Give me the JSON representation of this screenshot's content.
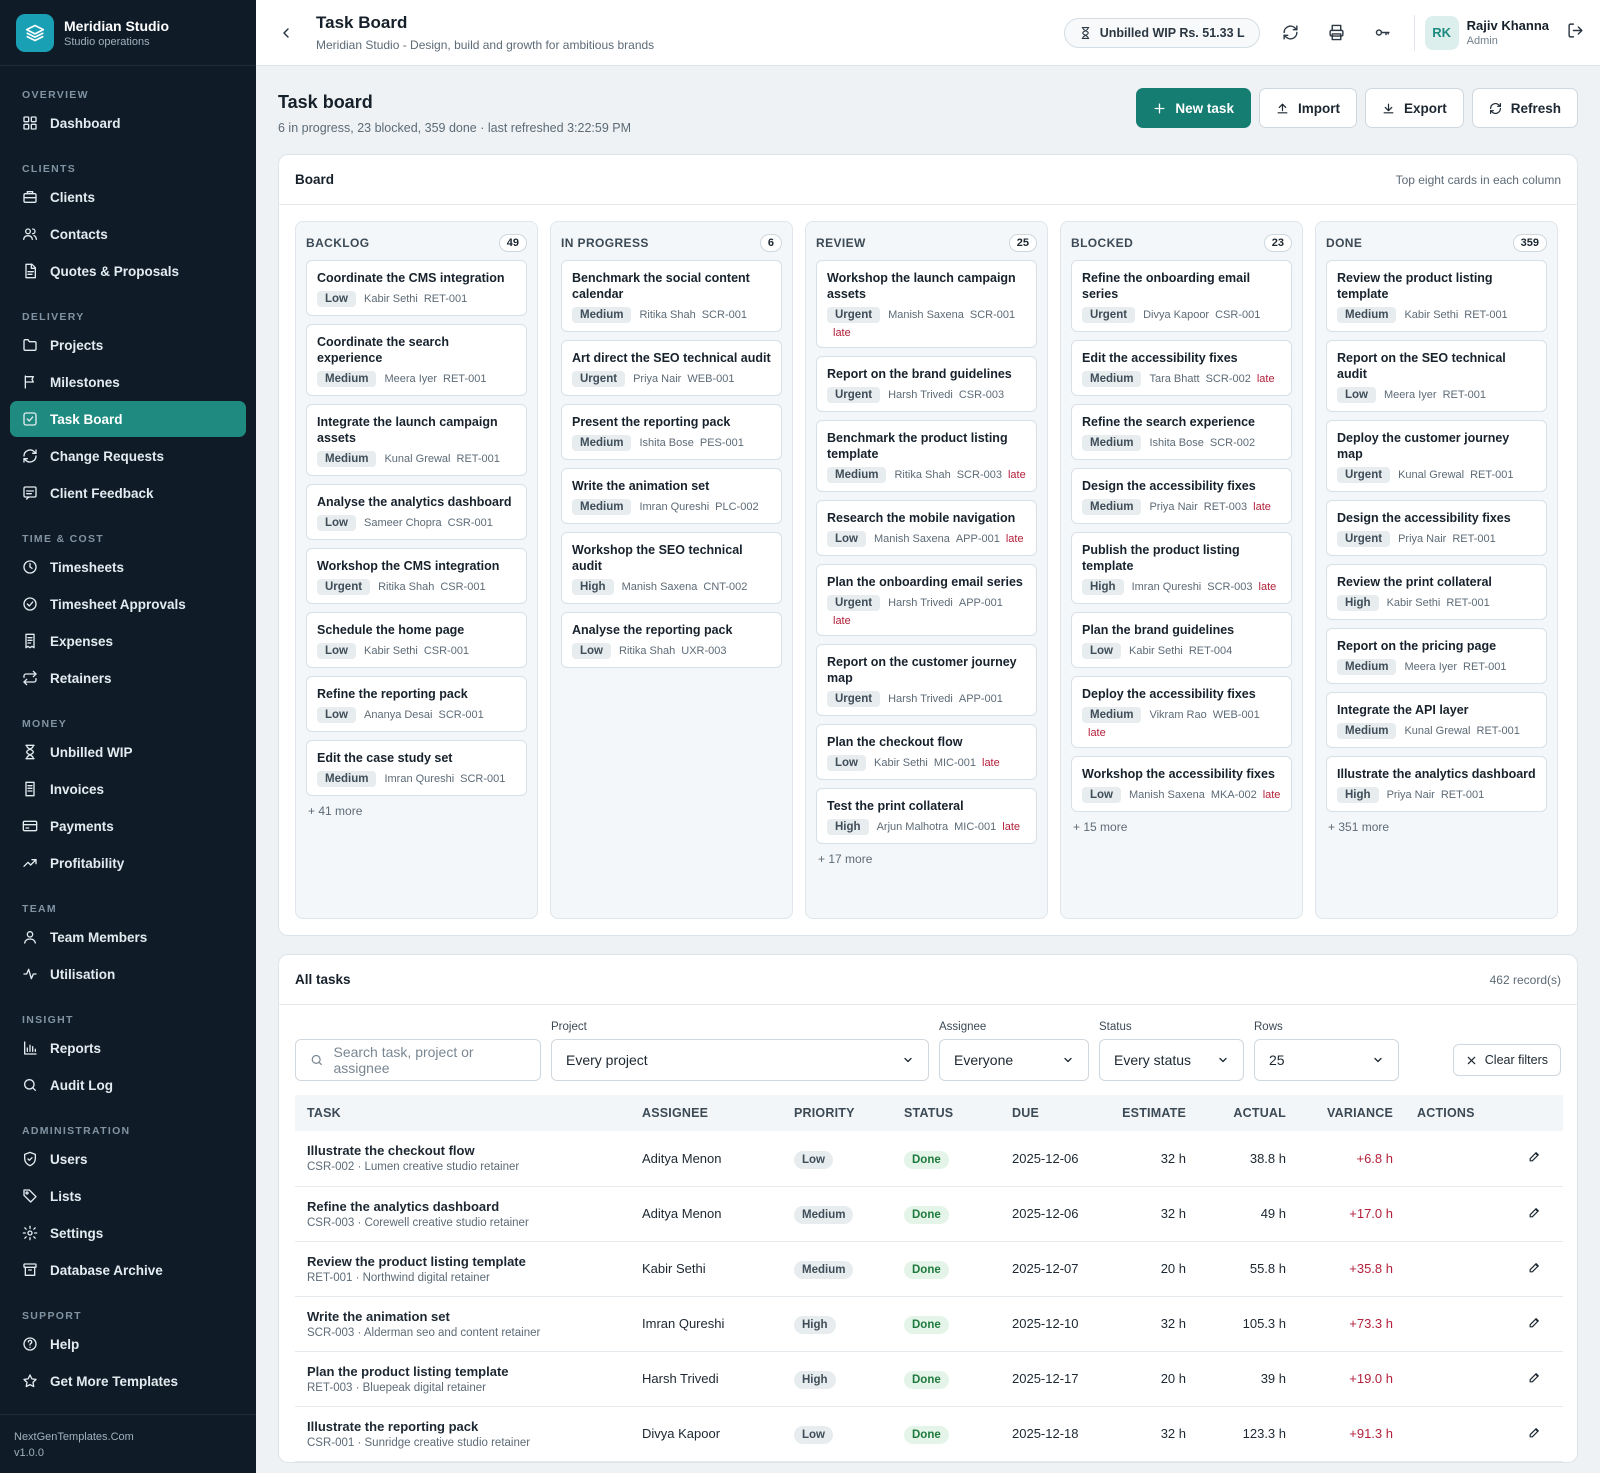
{
  "brand": {
    "name": "Meridian Studio",
    "subtitle": "Studio operations"
  },
  "nav": {
    "sections": [
      {
        "label": "OVERVIEW",
        "items": [
          {
            "label": "Dashboard",
            "icon": "grid-icon"
          }
        ]
      },
      {
        "label": "CLIENTS",
        "items": [
          {
            "label": "Clients",
            "icon": "briefcase-icon"
          },
          {
            "label": "Contacts",
            "icon": "users-icon"
          },
          {
            "label": "Quotes & Proposals",
            "icon": "document-icon"
          }
        ]
      },
      {
        "label": "DELIVERY",
        "items": [
          {
            "label": "Projects",
            "icon": "folder-icon"
          },
          {
            "label": "Milestones",
            "icon": "flag-icon"
          },
          {
            "label": "Task Board",
            "icon": "checkbox-icon",
            "active": true
          },
          {
            "label": "Change Requests",
            "icon": "refresh-icon"
          },
          {
            "label": "Client Feedback",
            "icon": "message-icon"
          }
        ]
      },
      {
        "label": "TIME & COST",
        "items": [
          {
            "label": "Timesheets",
            "icon": "clock-icon"
          },
          {
            "label": "Timesheet Approvals",
            "icon": "check-circle-icon"
          },
          {
            "label": "Expenses",
            "icon": "receipt-icon"
          },
          {
            "label": "Retainers",
            "icon": "repeat-icon"
          }
        ]
      },
      {
        "label": "MONEY",
        "items": [
          {
            "label": "Unbilled WIP",
            "icon": "hourglass-icon"
          },
          {
            "label": "Invoices",
            "icon": "invoice-icon"
          },
          {
            "label": "Payments",
            "icon": "card-icon"
          },
          {
            "label": "Profitability",
            "icon": "trend-icon"
          }
        ]
      },
      {
        "label": "TEAM",
        "items": [
          {
            "label": "Team Members",
            "icon": "user-icon"
          },
          {
            "label": "Utilisation",
            "icon": "pulse-icon"
          }
        ]
      },
      {
        "label": "INSIGHT",
        "items": [
          {
            "label": "Reports",
            "icon": "bar-chart-icon"
          },
          {
            "label": "Audit Log",
            "icon": "search-icon"
          }
        ]
      },
      {
        "label": "ADMINISTRATION",
        "items": [
          {
            "label": "Users",
            "icon": "shield-icon"
          },
          {
            "label": "Lists",
            "icon": "tag-icon"
          },
          {
            "label": "Settings",
            "icon": "gear-icon"
          },
          {
            "label": "Database Archive",
            "icon": "archive-icon"
          }
        ]
      },
      {
        "label": "SUPPORT",
        "items": [
          {
            "label": "Help",
            "icon": "help-icon"
          },
          {
            "label": "Get More Templates",
            "icon": "star-icon"
          }
        ]
      }
    ]
  },
  "footer": {
    "site": "NextGenTemplates.Com",
    "version": "v1.0.0"
  },
  "header": {
    "title": "Task Board",
    "subtitle": "Meridian Studio - Design, build and growth for ambitious brands",
    "wip": "Unbilled WIP Rs. 51.33 L",
    "user": {
      "initials": "RK",
      "name": "Rajiv Khanna",
      "role": "Admin"
    }
  },
  "page": {
    "title": "Task board",
    "subtitle": "6 in progress, 23 blocked, 359 done · last refreshed 3:22:59 PM",
    "actions": {
      "new": "New task",
      "import": "Import",
      "export": "Export",
      "refresh": "Refresh"
    }
  },
  "board": {
    "title": "Board",
    "note": "Top eight cards in each column",
    "columns": [
      {
        "name": "BACKLOG",
        "count": "49",
        "more": "+ 41 more",
        "cards": [
          {
            "title": "Coordinate the CMS integration",
            "priority": "Low",
            "assignee": "Kabir Sethi",
            "code": "RET-001",
            "late": ""
          },
          {
            "title": "Coordinate the search experience",
            "priority": "Medium",
            "assignee": "Meera Iyer",
            "code": "RET-001",
            "late": ""
          },
          {
            "title": "Integrate the launch campaign assets",
            "priority": "Medium",
            "assignee": "Kunal Grewal",
            "code": "RET-001",
            "late": ""
          },
          {
            "title": "Analyse the analytics dashboard",
            "priority": "Low",
            "assignee": "Sameer Chopra",
            "code": "CSR-001",
            "late": ""
          },
          {
            "title": "Workshop the CMS integration",
            "priority": "Urgent",
            "assignee": "Ritika Shah",
            "code": "CSR-001",
            "late": ""
          },
          {
            "title": "Schedule the home page",
            "priority": "Low",
            "assignee": "Kabir Sethi",
            "code": "CSR-001",
            "late": ""
          },
          {
            "title": "Refine the reporting pack",
            "priority": "Low",
            "assignee": "Ananya Desai",
            "code": "SCR-001",
            "late": ""
          },
          {
            "title": "Edit the case study set",
            "priority": "Medium",
            "assignee": "Imran Qureshi",
            "code": "SCR-001",
            "late": ""
          }
        ]
      },
      {
        "name": "IN PROGRESS",
        "count": "6",
        "more": "",
        "cards": [
          {
            "title": "Benchmark the social content calendar",
            "priority": "Medium",
            "assignee": "Ritika Shah",
            "code": "SCR-001",
            "late": ""
          },
          {
            "title": "Art direct the SEO technical audit",
            "priority": "Urgent",
            "assignee": "Priya Nair",
            "code": "WEB-001",
            "late": ""
          },
          {
            "title": "Present the reporting pack",
            "priority": "Medium",
            "assignee": "Ishita Bose",
            "code": "PES-001",
            "late": ""
          },
          {
            "title": "Write the animation set",
            "priority": "Medium",
            "assignee": "Imran Qureshi",
            "code": "PLC-002",
            "late": ""
          },
          {
            "title": "Workshop the SEO technical audit",
            "priority": "High",
            "assignee": "Manish Saxena",
            "code": "CNT-002",
            "late": ""
          },
          {
            "title": "Analyse the reporting pack",
            "priority": "Low",
            "assignee": "Ritika Shah",
            "code": "UXR-003",
            "late": ""
          }
        ]
      },
      {
        "name": "REVIEW",
        "count": "25",
        "more": "+ 17 more",
        "cards": [
          {
            "title": "Workshop the launch campaign assets",
            "priority": "Urgent",
            "assignee": "Manish Saxena",
            "code": "SCR-001",
            "late": "late"
          },
          {
            "title": "Report on the brand guidelines",
            "priority": "Urgent",
            "assignee": "Harsh Trivedi",
            "code": "CSR-003",
            "late": ""
          },
          {
            "title": "Benchmark the product listing template",
            "priority": "Medium",
            "assignee": "Ritika Shah",
            "code": "SCR-003",
            "late": "late"
          },
          {
            "title": "Research the mobile navigation",
            "priority": "Low",
            "assignee": "Manish Saxena",
            "code": "APP-001",
            "late": "late"
          },
          {
            "title": "Plan the onboarding email series",
            "priority": "Urgent",
            "assignee": "Harsh Trivedi",
            "code": "APP-001",
            "late": "late"
          },
          {
            "title": "Report on the customer journey map",
            "priority": "Urgent",
            "assignee": "Harsh Trivedi",
            "code": "APP-001",
            "late": ""
          },
          {
            "title": "Plan the checkout flow",
            "priority": "Low",
            "assignee": "Kabir Sethi",
            "code": "MIC-001",
            "late": "late"
          },
          {
            "title": "Test the print collateral",
            "priority": "High",
            "assignee": "Arjun Malhotra",
            "code": "MIC-001",
            "late": "late"
          }
        ]
      },
      {
        "name": "BLOCKED",
        "count": "23",
        "more": "+ 15 more",
        "cards": [
          {
            "title": "Refine the onboarding email series",
            "priority": "Urgent",
            "assignee": "Divya Kapoor",
            "code": "CSR-001",
            "late": ""
          },
          {
            "title": "Edit the accessibility fixes",
            "priority": "Medium",
            "assignee": "Tara Bhatt",
            "code": "SCR-002",
            "late": "late"
          },
          {
            "title": "Refine the search experience",
            "priority": "Medium",
            "assignee": "Ishita Bose",
            "code": "SCR-002",
            "late": ""
          },
          {
            "title": "Design the accessibility fixes",
            "priority": "Medium",
            "assignee": "Priya Nair",
            "code": "RET-003",
            "late": "late"
          },
          {
            "title": "Publish the product listing template",
            "priority": "High",
            "assignee": "Imran Qureshi",
            "code": "SCR-003",
            "late": "late"
          },
          {
            "title": "Plan the brand guidelines",
            "priority": "Low",
            "assignee": "Kabir Sethi",
            "code": "RET-004",
            "late": ""
          },
          {
            "title": "Deploy the accessibility fixes",
            "priority": "Medium",
            "assignee": "Vikram Rao",
            "code": "WEB-001",
            "late": "late"
          },
          {
            "title": "Workshop the accessibility fixes",
            "priority": "Low",
            "assignee": "Manish Saxena",
            "code": "MKA-002",
            "late": "late"
          }
        ]
      },
      {
        "name": "DONE",
        "count": "359",
        "more": "+ 351 more",
        "cards": [
          {
            "title": "Review the product listing template",
            "priority": "Medium",
            "assignee": "Kabir Sethi",
            "code": "RET-001",
            "late": ""
          },
          {
            "title": "Report on the SEO technical audit",
            "priority": "Low",
            "assignee": "Meera Iyer",
            "code": "RET-001",
            "late": ""
          },
          {
            "title": "Deploy the customer journey map",
            "priority": "Urgent",
            "assignee": "Kunal Grewal",
            "code": "RET-001",
            "late": ""
          },
          {
            "title": "Design the accessibility fixes",
            "priority": "Urgent",
            "assignee": "Priya Nair",
            "code": "RET-001",
            "late": ""
          },
          {
            "title": "Review the print collateral",
            "priority": "High",
            "assignee": "Kabir Sethi",
            "code": "RET-001",
            "late": ""
          },
          {
            "title": "Report on the pricing page",
            "priority": "Medium",
            "assignee": "Meera Iyer",
            "code": "RET-001",
            "late": ""
          },
          {
            "title": "Integrate the API layer",
            "priority": "Medium",
            "assignee": "Kunal Grewal",
            "code": "RET-001",
            "late": ""
          },
          {
            "title": "Illustrate the analytics dashboard",
            "priority": "High",
            "assignee": "Priya Nair",
            "code": "RET-001",
            "late": ""
          }
        ]
      }
    ]
  },
  "tasks": {
    "title": "All tasks",
    "records": "462 record(s)",
    "filters": {
      "search_placeholder": "Search task, project or assignee",
      "project_label": "Project",
      "project_value": "Every project",
      "assignee_label": "Assignee",
      "assignee_value": "Everyone",
      "status_label": "Status",
      "status_value": "Every status",
      "rows_label": "Rows",
      "rows_value": "25",
      "clear": "Clear filters"
    },
    "columns": [
      "TASK",
      "ASSIGNEE",
      "PRIORITY",
      "STATUS",
      "DUE",
      "ESTIMATE",
      "ACTUAL",
      "VARIANCE",
      "ACTIONS"
    ],
    "rows": [
      {
        "title": "Illustrate the checkout flow",
        "sub": "CSR-002 · Lumen creative studio retainer",
        "assignee": "Aditya Menon",
        "priority": "Low",
        "status": "Done",
        "due": "2025-12-06",
        "estimate": "32 h",
        "actual": "38.8 h",
        "variance": "+6.8 h"
      },
      {
        "title": "Refine the analytics dashboard",
        "sub": "CSR-003 · Corewell creative studio retainer",
        "assignee": "Aditya Menon",
        "priority": "Medium",
        "status": "Done",
        "due": "2025-12-06",
        "estimate": "32 h",
        "actual": "49 h",
        "variance": "+17.0 h"
      },
      {
        "title": "Review the product listing template",
        "sub": "RET-001 · Northwind digital retainer",
        "assignee": "Kabir Sethi",
        "priority": "Medium",
        "status": "Done",
        "due": "2025-12-07",
        "estimate": "20 h",
        "actual": "55.8 h",
        "variance": "+35.8 h"
      },
      {
        "title": "Write the animation set",
        "sub": "SCR-003 · Alderman seo and content retainer",
        "assignee": "Imran Qureshi",
        "priority": "High",
        "status": "Done",
        "due": "2025-12-10",
        "estimate": "32 h",
        "actual": "105.3 h",
        "variance": "+73.3 h"
      },
      {
        "title": "Plan the product listing template",
        "sub": "RET-003 · Bluepeak digital retainer",
        "assignee": "Harsh Trivedi",
        "priority": "High",
        "status": "Done",
        "due": "2025-12-17",
        "estimate": "20 h",
        "actual": "39 h",
        "variance": "+19.0 h"
      },
      {
        "title": "Illustrate the reporting pack",
        "sub": "CSR-001 · Sunridge creative studio retainer",
        "assignee": "Divya Kapoor",
        "priority": "Low",
        "status": "Done",
        "due": "2025-12-18",
        "estimate": "32 h",
        "actual": "123.3 h",
        "variance": "+91.3 h"
      }
    ]
  }
}
